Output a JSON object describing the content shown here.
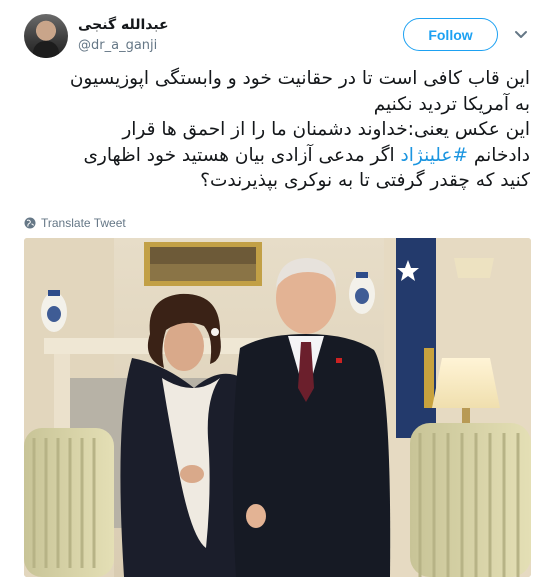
{
  "author": {
    "display_name": "عبدالله گنجی",
    "handle": "@dr_a_ganji"
  },
  "follow_label": "Follow",
  "tweet": {
    "lines": [
      "این قاب کافی است تا در حقانیت خود و وابستگی اپوزیسیون",
      "به آمریکا  تردید نکنیم",
      "این عکس یعنی:خداوند دشمنان ما را از احمق ها قرار",
      "دادخانم ",
      "#علینژاد",
      " اگر مدعی آزادی بیان هستید خود اظهاری",
      "کنید که چقدر گرفتی تا به نوکری بپذیرندت؟"
    ]
  },
  "translate_label": "Translate Tweet",
  "colors": {
    "accent": "#1da1f2",
    "link": "#1b95e0",
    "secondary_text": "#657786"
  },
  "icons": {
    "translate": "globe-icon",
    "menu": "chevron-down-icon"
  }
}
